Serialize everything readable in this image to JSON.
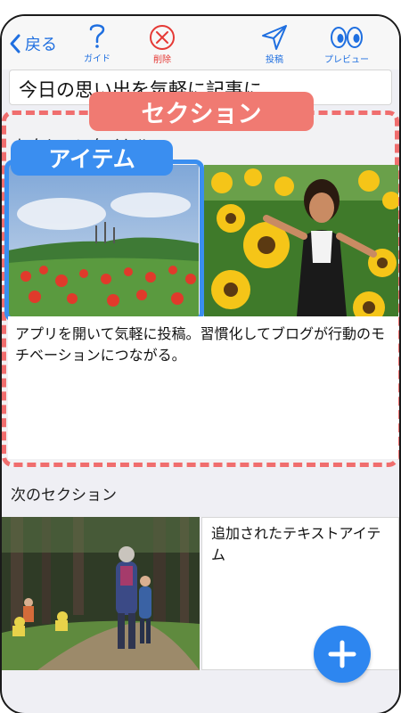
{
  "toolbar": {
    "back_label": "戻る",
    "guide_label": "ガイド",
    "delete_label": "削除",
    "post_label": "投稿",
    "preview_label": "プレビュー",
    "accent_color": "#1f6fe0",
    "delete_color": "#e53935"
  },
  "post": {
    "title": "今日の思い出を気軽に記事に"
  },
  "annotations": {
    "section_label": "セクション",
    "item_label": "アイテム",
    "section_color": "#f07a72",
    "item_color": "#3a8ef0"
  },
  "sections": [
    {
      "title": "セクションタイトル",
      "images": [
        "mountain-flower-field-photo",
        "sunflower-field-woman-photo"
      ],
      "text": "アプリを開いて気軽に投稿。習慣化してブログが行動のモチベーションにつながる。"
    },
    {
      "title": "次のセクション",
      "images": [
        "forest-path-family-photo"
      ],
      "text": "追加されたテキストアイテム"
    }
  ],
  "fab": {
    "icon": "plus-icon",
    "color": "#2d86f0"
  }
}
